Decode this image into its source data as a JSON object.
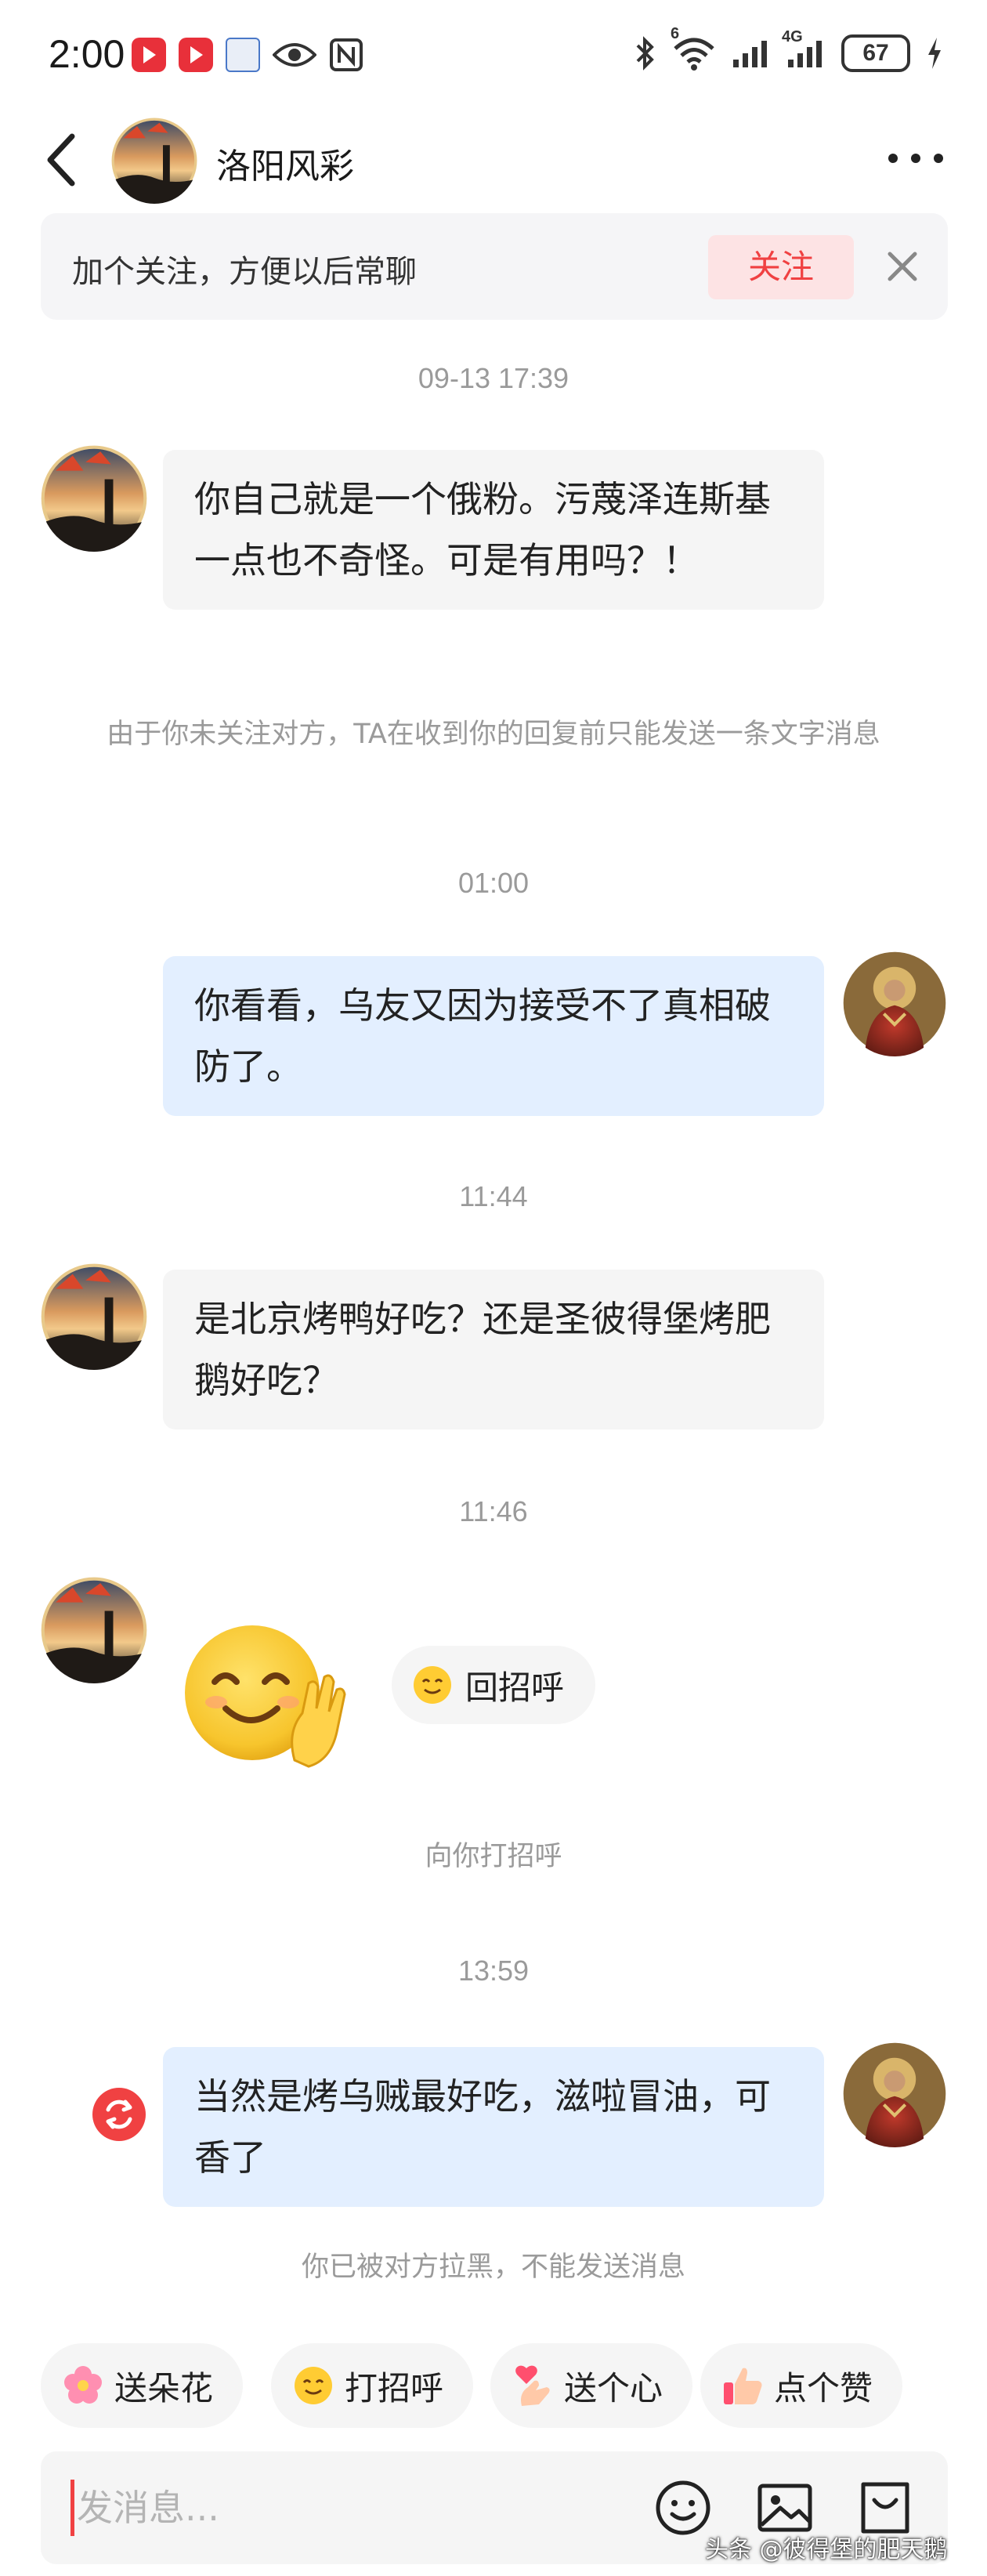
{
  "status_bar": {
    "time": "2:00",
    "battery": "67",
    "network_badge_1": "6",
    "network_badge_2": "4G"
  },
  "header": {
    "title": "洛阳风彩"
  },
  "follow_banner": {
    "text": "加个关注，方便以后常聊",
    "follow_label": "关注"
  },
  "messages": [
    {
      "time": "09-13 17:39",
      "direction": "in",
      "text": "你自己就是一个俄粉。污蔑泽连斯基一点也不奇怪。可是有用吗？！"
    },
    {
      "notice": "由于你未关注对方，TA在收到你的回复前只能发送一条文字消息"
    },
    {
      "time": "01:00",
      "direction": "out",
      "text": "你看看，乌友又因为接受不了真相破防了。"
    },
    {
      "time": "11:44",
      "direction": "in",
      "text": "是北京烤鸭好吃？还是圣彼得堡烤肥鹅好吃？"
    },
    {
      "time": "11:46",
      "direction": "in",
      "type": "greeting-sticker",
      "reply_label": "回招呼"
    },
    {
      "notice": "向你打招呼"
    },
    {
      "time": "13:59",
      "direction": "out",
      "text": "当然是烤乌贼最好吃，滋啦冒油，可香了",
      "status": "failed"
    },
    {
      "notice": "你已被对方拉黑，不能发送消息"
    }
  ],
  "quick_actions": [
    {
      "label": "送朵花",
      "icon": "flower-icon"
    },
    {
      "label": "打招呼",
      "icon": "smile-icon"
    },
    {
      "label": "送个心",
      "icon": "heart-hand-icon"
    },
    {
      "label": "点个赞",
      "icon": "thumbs-up-icon"
    }
  ],
  "input": {
    "placeholder": "发消息..."
  },
  "colors": {
    "accent_red": "#f04142",
    "outgoing_bubble": "#e3efff",
    "incoming_bubble": "#f5f5f5",
    "follow_button_bg": "#fde3e4"
  },
  "watermark": "头条 @彼得堡的肥天鹅"
}
